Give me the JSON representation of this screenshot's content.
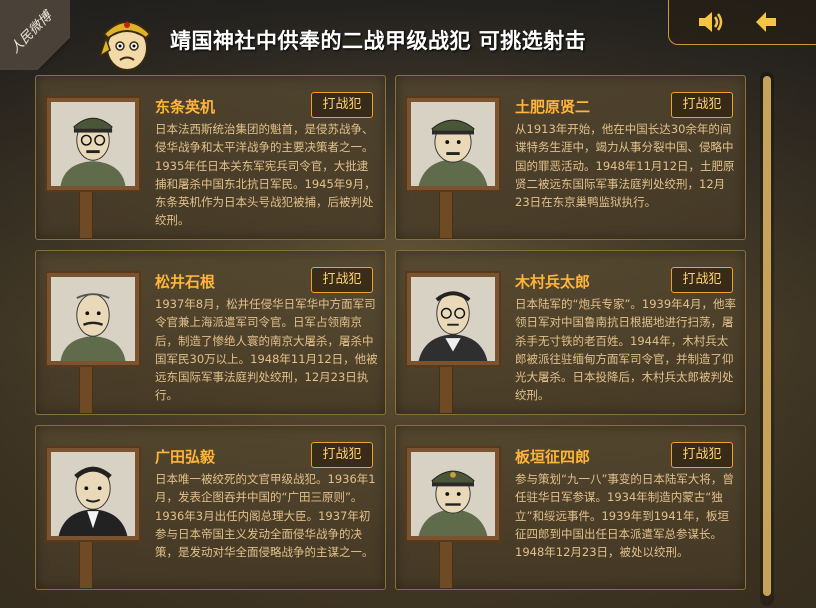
{
  "header": {
    "corner_badge": "人民微博",
    "title": "靖国神社中供奉的二战甲级战犯 可挑选射击",
    "icons": [
      "sound-icon",
      "back-arrow-icon"
    ]
  },
  "cards": [
    {
      "name": "东条英机",
      "button": "打战犯",
      "desc": "日本法西斯统治集团的魁首，是侵苏战争、侵华战争和太平洋战争的主要决策者之一。1935年任日本关东军宪兵司令官，大批逮捕和屠杀中国东北抗日军民。1945年9月，东条英机作为日本头号战犯被捕，后被判处绞刑。"
    },
    {
      "name": "土肥原贤二",
      "button": "打战犯",
      "desc": "从1913年开始，他在中国长达30余年的间谍特务生涯中，竭力从事分裂中国、侵略中国的罪恶活动。1948年11月12日，土肥原贤二被远东国际军事法庭判处绞刑，12月23日在东京巢鸭监狱执行。"
    },
    {
      "name": "松井石根",
      "button": "打战犯",
      "desc": "1937年8月，松井任侵华日军华中方面军司令官兼上海派遣军司令官。日军占领南京后，制造了惨绝人寰的南京大屠杀，屠杀中国军民30万以上。1948年11月12日，他被远东国际军事法庭判处绞刑，12月23日执行。"
    },
    {
      "name": "木村兵太郎",
      "button": "打战犯",
      "desc": "日本陆军的“炮兵专家”。1939年4月，他率领日军对中国鲁南抗日根据地进行扫荡，屠杀手无寸铁的老百姓。1944年，木村兵太郎被派往驻缅甸方面军司令官，并制造了仰光大屠杀。日本投降后，木村兵太郎被判处绞刑。"
    },
    {
      "name": "广田弘毅",
      "button": "打战犯",
      "desc": "日本唯一被绞死的文官甲级战犯。1936年1月，发表企图吞并中国的“广田三原则”。1936年3月出任内阁总理大臣。1937年初参与日本帝国主义发动全面侵华战争的决策，是发动对华全面侵略战争的主谋之一。"
    },
    {
      "name": "板垣征四郎",
      "button": "打战犯",
      "desc": "参与策划“九一八”事变的日本陆军大将，曾任驻华日军参谋。1934年制造内蒙古“独立”和绥远事件。1939年到1941年，板垣征四郎到中国出任日本派遣军总参谋长。1948年12月23日，被处以绞刑。"
    }
  ],
  "colors": {
    "accent": "#ffb43a",
    "button_border": "#f0a030",
    "desc_text": "#e2c08a"
  }
}
